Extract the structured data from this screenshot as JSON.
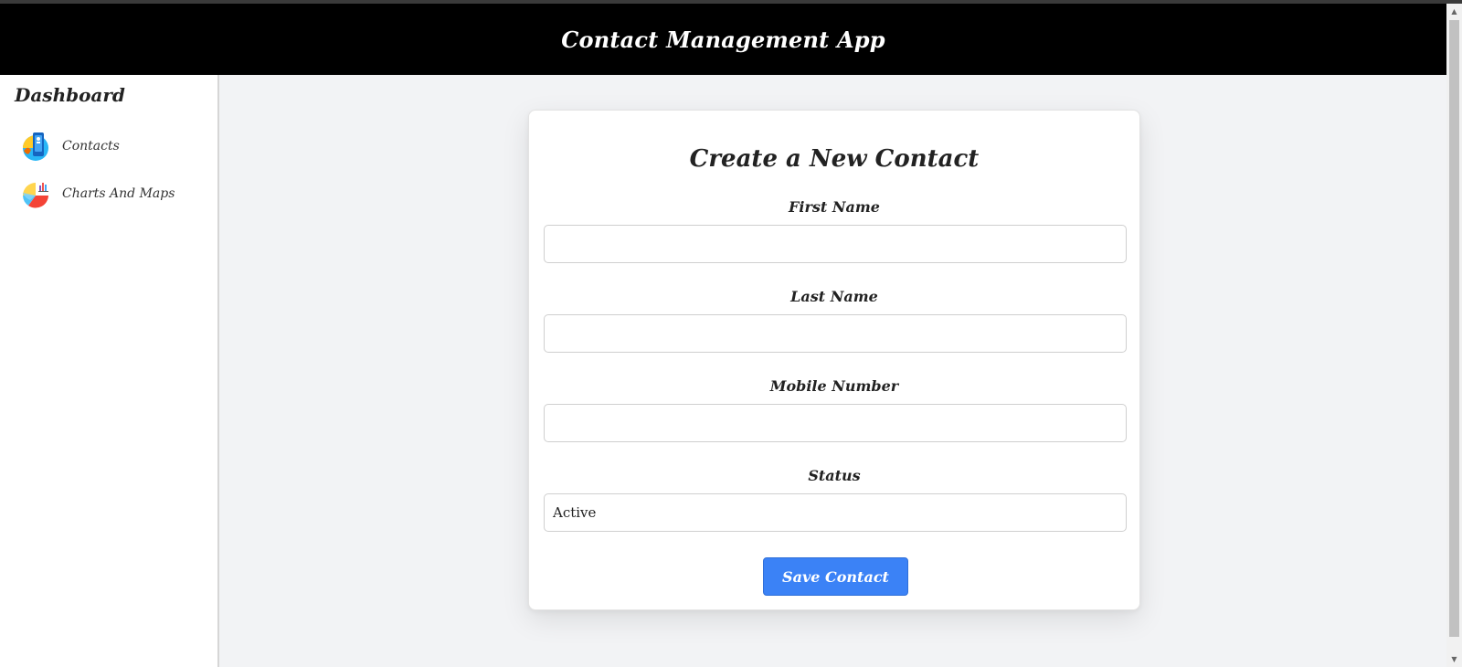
{
  "header": {
    "title": "Contact Management App"
  },
  "sidebar": {
    "heading": "Dashboard",
    "items": [
      {
        "label": "Contacts",
        "icon": "contacts-phone-icon"
      },
      {
        "label": "Charts And Maps",
        "icon": "pie-chart-icon"
      }
    ]
  },
  "form": {
    "title": "Create a New Contact",
    "fields": [
      {
        "label": "First Name",
        "value": "",
        "placeholder": ""
      },
      {
        "label": "Last Name",
        "value": "",
        "placeholder": ""
      },
      {
        "label": "Mobile Number",
        "value": "",
        "placeholder": ""
      }
    ],
    "status": {
      "label": "Status",
      "selected": "Active"
    },
    "submit_label": "Save Contact"
  },
  "colors": {
    "header_bg": "#000000",
    "button_bg": "#3b82f6",
    "page_bg": "#f2f3f5"
  }
}
